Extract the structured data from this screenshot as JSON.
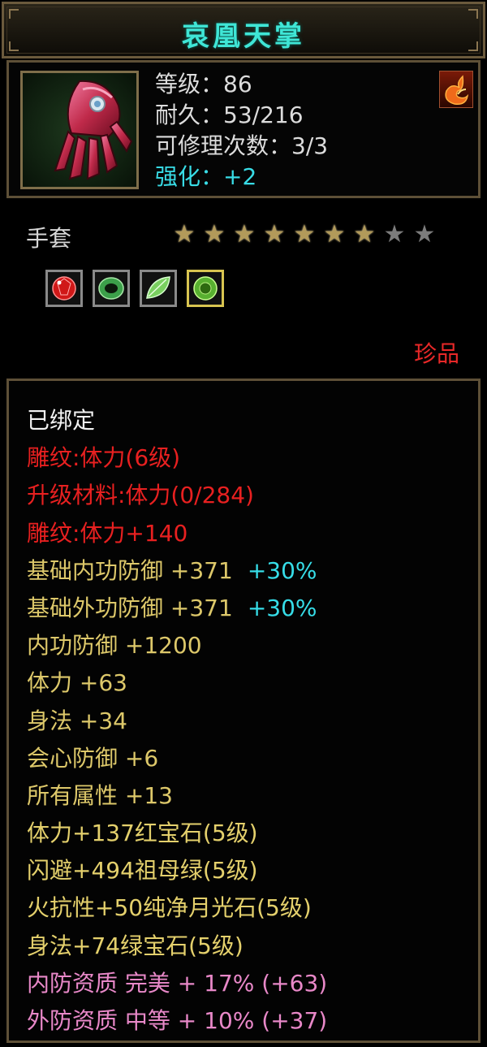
{
  "title": "哀凰天掌",
  "item": {
    "icon": "glove-icon",
    "level": "等级：86",
    "durability": "耐久：53/216",
    "repair_count": "可修理次数：3/3",
    "enhance_label": "强化：",
    "enhance_value": "+2",
    "element_icon": "fire-element-icon"
  },
  "type_label": "手套",
  "stars": {
    "filled": 7,
    "total": 9
  },
  "sockets": [
    {
      "icon": "ruby-gem-icon",
      "color": "#d01818",
      "selected": false
    },
    {
      "icon": "jade-ring-icon",
      "color": "#3ca04a",
      "selected": false
    },
    {
      "icon": "jade-leaf-icon",
      "color": "#7ad060",
      "selected": false
    },
    {
      "icon": "emerald-gem-icon",
      "color": "#58b030",
      "selected": true
    }
  ],
  "rarity": "珍品",
  "attributes": {
    "bound": "已绑定",
    "engrave_level": "雕纹:体力(6级)",
    "upgrade_material": "升级材料:体力(0/284)",
    "engrave_bonus": "雕纹:体力+140",
    "base_inner_def": "基础内功防御 +371",
    "base_inner_def_pct": "+30%",
    "base_outer_def": "基础外功防御 +371",
    "base_outer_def_pct": "+30%",
    "inner_def": "内功防御 +1200",
    "stamina": "体力 +63",
    "agility": "身法 +34",
    "crit_def": "会心防御 +6",
    "all_attr": "所有属性 +13",
    "gem1": "体力+137红宝石(5级)",
    "gem2": "闪避+494祖母绿(5级)",
    "gem3": "火抗性+50纯净月光石(5级)",
    "gem4": "身法+74绿宝石(5级)",
    "quality_inner": "内防资质 完美 + 17% (+63)",
    "quality_outer": "外防资质 中等 + 10% (+37)"
  },
  "colors": {
    "title": "#3fe6d6",
    "red": "#e82020",
    "yellow": "#ddc86a",
    "cyan": "#36dde8",
    "pink": "#e888c8",
    "border": "#5e5037"
  }
}
